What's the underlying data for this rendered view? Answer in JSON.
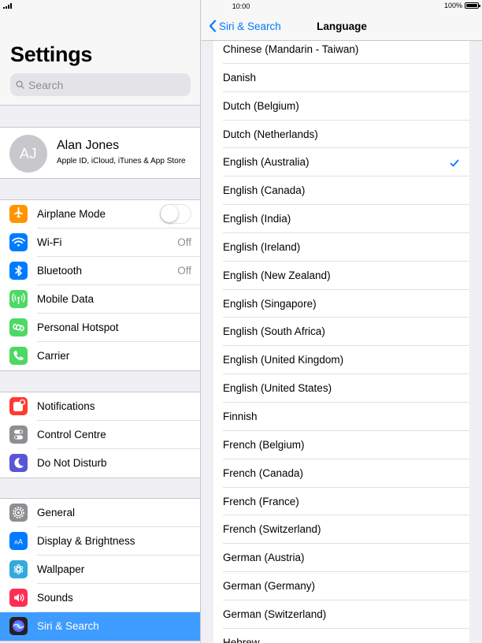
{
  "status": {
    "time": "10:00",
    "battery": "100%",
    "battery_level": 1.0
  },
  "left": {
    "title": "Settings",
    "search_placeholder": "Search",
    "profile": {
      "initials": "AJ",
      "name": "Alan Jones",
      "subtitle": "Apple ID, iCloud, iTunes & App Store"
    },
    "group1": [
      {
        "label": "Airplane Mode",
        "icon": "airplane-icon",
        "color": "#ff9500",
        "toggle": false
      },
      {
        "label": "Wi-Fi",
        "icon": "wifi-icon",
        "color": "#007aff",
        "value": "Off"
      },
      {
        "label": "Bluetooth",
        "icon": "bluetooth-icon",
        "color": "#007aff",
        "value": "Off"
      },
      {
        "label": "Mobile Data",
        "icon": "antenna-icon",
        "color": "#4cd964"
      },
      {
        "label": "Personal Hotspot",
        "icon": "hotspot-icon",
        "color": "#4cd964"
      },
      {
        "label": "Carrier",
        "icon": "phone-icon",
        "color": "#4cd964"
      }
    ],
    "group2": [
      {
        "label": "Notifications",
        "icon": "notifications-icon",
        "color": "#ff3b30"
      },
      {
        "label": "Control Centre",
        "icon": "control-centre-icon",
        "color": "#8e8e93"
      },
      {
        "label": "Do Not Disturb",
        "icon": "moon-icon",
        "color": "#5856d6"
      }
    ],
    "group3": [
      {
        "label": "General",
        "icon": "gear-icon",
        "color": "#8e8e93"
      },
      {
        "label": "Display & Brightness",
        "icon": "display-icon",
        "color": "#007aff"
      },
      {
        "label": "Wallpaper",
        "icon": "wallpaper-icon",
        "color": "#34aadc"
      },
      {
        "label": "Sounds",
        "icon": "speaker-icon",
        "color": "#ff2d55"
      },
      {
        "label": "Siri & Search",
        "icon": "siri-icon",
        "color": "#222",
        "selected": true
      }
    ]
  },
  "right": {
    "back_label": "Siri & Search",
    "title": "Language",
    "selected": "English (Australia)",
    "languages": [
      "Chinese (Mandarin - Taiwan)",
      "Danish",
      "Dutch (Belgium)",
      "Dutch (Netherlands)",
      "English (Australia)",
      "English (Canada)",
      "English (India)",
      "English (Ireland)",
      "English (New Zealand)",
      "English (Singapore)",
      "English (South Africa)",
      "English (United Kingdom)",
      "English (United States)",
      "Finnish",
      "French (Belgium)",
      "French (Canada)",
      "French (France)",
      "French (Switzerland)",
      "German (Austria)",
      "German (Germany)",
      "German (Switzerland)",
      "Hebrew"
    ]
  },
  "colors": {
    "accent": "#007aff",
    "selection": "#3e9bff"
  }
}
